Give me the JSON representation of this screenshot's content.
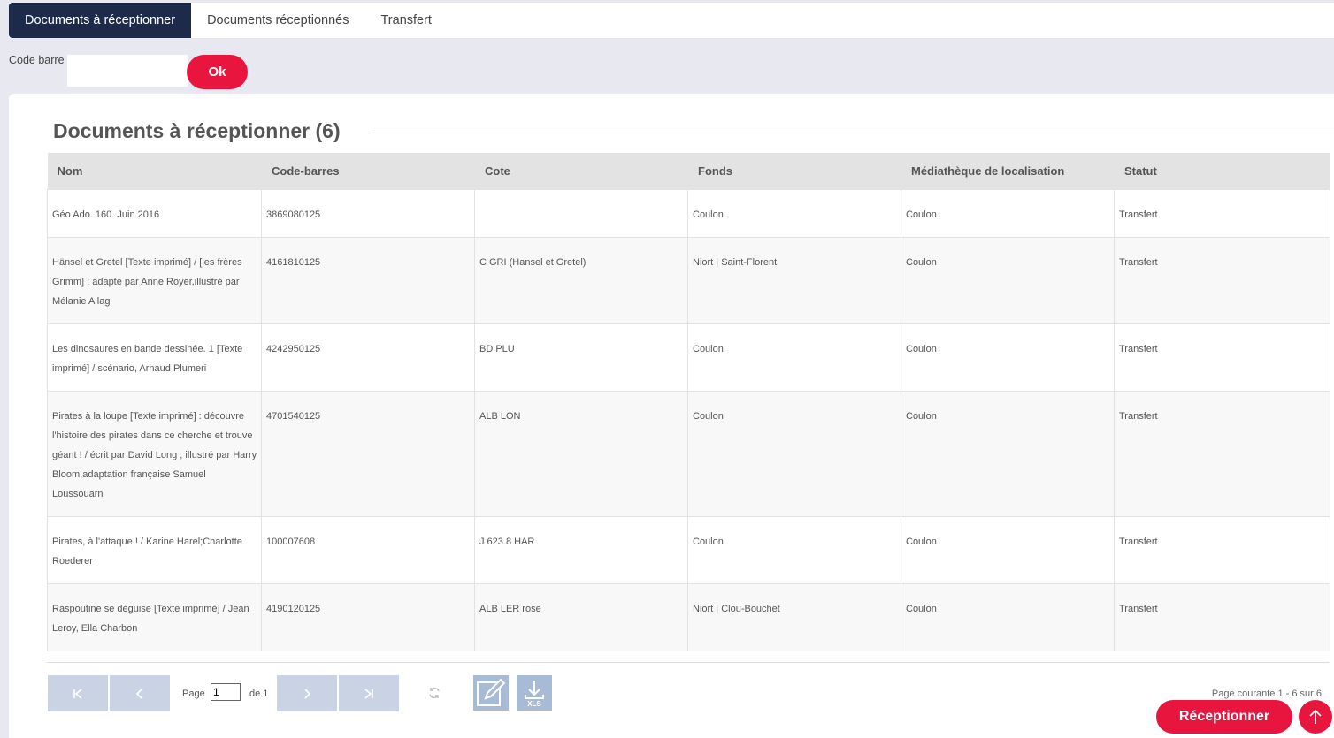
{
  "tabs": [
    {
      "label": "Documents à réceptionner",
      "active": true
    },
    {
      "label": "Documents réceptionnés",
      "active": false
    },
    {
      "label": "Transfert",
      "active": false
    }
  ],
  "barcode": {
    "label": "Code barre",
    "value": "",
    "ok_label": "Ok"
  },
  "panel": {
    "title": "Documents à réceptionner (6)"
  },
  "table": {
    "columns": [
      "Nom",
      "Code-barres",
      "Cote",
      "Fonds",
      "Médiathèque de localisation",
      "Statut"
    ],
    "rows": [
      {
        "nom": "Géo Ado. 160. Juin 2016",
        "code": "3869080125",
        "cote": "",
        "fonds": "Coulon",
        "mediatheque": "Coulon",
        "statut": "Transfert"
      },
      {
        "nom": "Hänsel et Gretel [Texte imprimé] / [les frères Grimm] ; adapté par Anne Royer,illustré par Mélanie Allag",
        "code": "4161810125",
        "cote": "C GRI (Hansel et Gretel)",
        "fonds": "Niort | Saint-Florent",
        "mediatheque": "Coulon",
        "statut": "Transfert"
      },
      {
        "nom": "Les dinosaures en bande dessinée. 1 [Texte imprimé] / scénario, Arnaud Plumeri",
        "code": "4242950125",
        "cote": "BD PLU",
        "fonds": "Coulon",
        "mediatheque": "Coulon",
        "statut": "Transfert"
      },
      {
        "nom": "Pirates à la loupe [Texte imprimé] : découvre l'histoire des pirates dans ce cherche et trouve géant ! / écrit par David Long ; illustré par Harry Bloom,adaptation française Samuel Loussouarn",
        "code": "4701540125",
        "cote": "ALB LON",
        "fonds": "Coulon",
        "mediatheque": "Coulon",
        "statut": "Transfert"
      },
      {
        "nom": "Pirates, à l'attaque ! / Karine Harel;Charlotte Roederer",
        "code": "100007608",
        "cote": "J 623.8 HAR",
        "fonds": "Coulon",
        "mediatheque": "Coulon",
        "statut": "Transfert"
      },
      {
        "nom": "Raspoutine se déguise [Texte imprimé] / Jean Leroy, Ella Charbon",
        "code": "4190120125",
        "cote": "ALB LER rose",
        "fonds": "Niort | Clou-Bouchet",
        "mediatheque": "Coulon",
        "statut": "Transfert"
      }
    ]
  },
  "pagination": {
    "page_label": "Page",
    "page_value": "1",
    "of_label": "de 1",
    "summary": "Page courante 1 - 6 sur 6",
    "first_icon": "first-page-icon",
    "prev_icon": "prev-page-icon",
    "next_icon": "next-page-icon",
    "last_icon": "last-page-icon",
    "refresh_icon": "refresh-icon",
    "edit_icon": "edit-icon",
    "xls_icon": "xls-download-icon",
    "xls_label": "XLS"
  },
  "actions": {
    "receive_label": "Réceptionner",
    "scroll_top_icon": "arrow-up-icon"
  },
  "colors": {
    "accent": "#e8163e",
    "tab_active": "#1c2b4a",
    "pager_button": "#c9d3e3",
    "icon_button": "#a8bbd6"
  }
}
